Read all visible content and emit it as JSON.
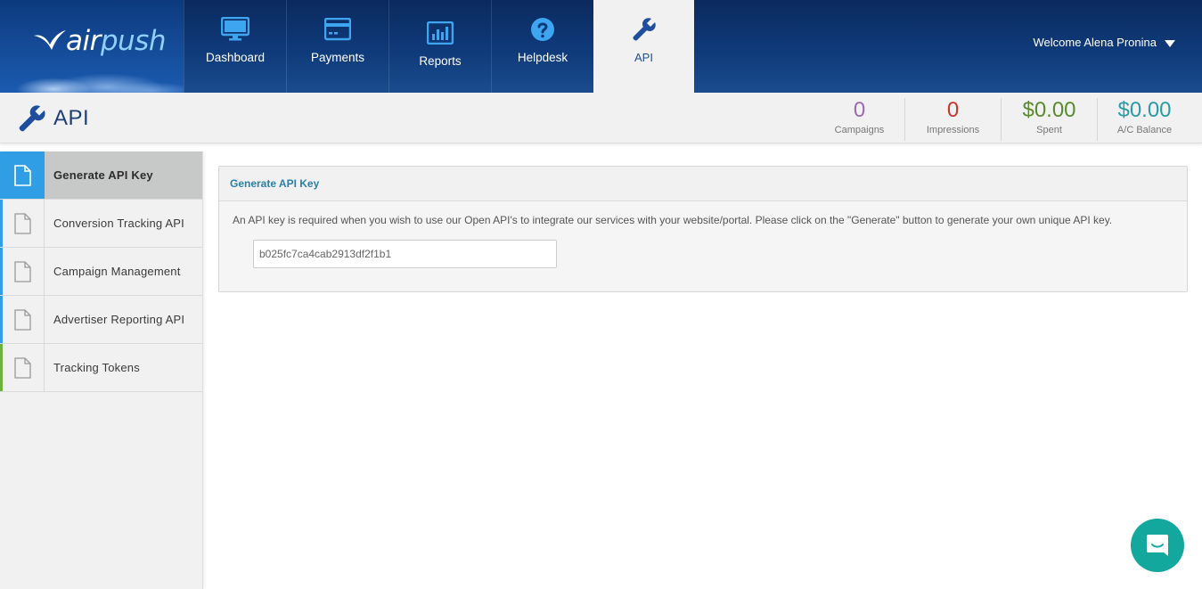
{
  "header": {
    "logo": {
      "part1": "air",
      "part2": "push"
    },
    "nav": [
      {
        "label": "Dashboard",
        "icon": "monitor-icon"
      },
      {
        "label": "Payments",
        "icon": "credit-card-icon"
      },
      {
        "label": "Reports",
        "icon": "bar-chart-icon"
      },
      {
        "label": "Helpdesk",
        "icon": "question-circle-icon"
      },
      {
        "label": "API",
        "icon": "wrench-icon",
        "active": true
      }
    ],
    "welcome": "Welcome Alena Pronina"
  },
  "page": {
    "title": "API",
    "stats": [
      {
        "value": "0",
        "label": "Campaigns",
        "color": "#9b6bb0"
      },
      {
        "value": "0",
        "label": "Impressions",
        "color": "#c0392b"
      },
      {
        "value": "$0.00",
        "label": "Spent",
        "color": "#5a8a2e"
      },
      {
        "value": "$0.00",
        "label": "A/C Balance",
        "color": "#2a9aa8"
      }
    ]
  },
  "sidebar": {
    "items": [
      {
        "label": "Generate API Key",
        "active": true,
        "accent": "#2f9ee4"
      },
      {
        "label": "Conversion Tracking API",
        "active": false,
        "accent": "#2f9ee4"
      },
      {
        "label": "Campaign Management",
        "active": false,
        "accent": "#2f9ee4"
      },
      {
        "label": "Advertiser Reporting API",
        "active": false,
        "accent": "#2f9ee4"
      },
      {
        "label": "Tracking Tokens",
        "active": false,
        "accent": "#6cb33e"
      }
    ]
  },
  "panel": {
    "heading": "Generate API Key",
    "description": "An API key is required when you wish to use our Open API's to integrate our services with your website/portal. Please click on the \"Generate\" button to generate your own unique API key.",
    "api_key_value": "b025fc7ca4cab2913df2f1b1"
  },
  "chat": {
    "icon": "chat-icon"
  },
  "colors": {
    "header_dark": "#0b2a5e",
    "accent_blue": "#2f9ee4",
    "chat_teal": "#13a89e"
  }
}
